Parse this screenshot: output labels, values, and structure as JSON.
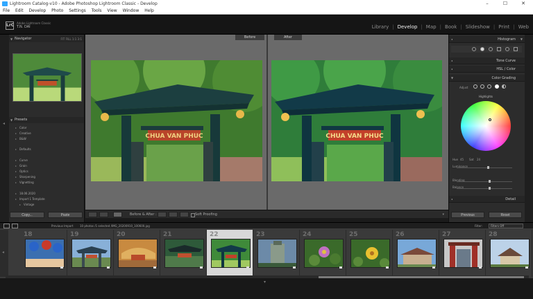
{
  "window": {
    "title": "Lightroom Catalog-v10 - Adobe Photoshop Lightroom Classic - Develop",
    "minimize": "–",
    "maximize": "☐",
    "close": "✕"
  },
  "menu": [
    "File",
    "Edit",
    "Develop",
    "Photo",
    "Settings",
    "Tools",
    "View",
    "Window",
    "Help"
  ],
  "identity": {
    "logo": "LrC",
    "line1": "Adobe Lightroom Classic",
    "line2": "T.N. DAI"
  },
  "modules": [
    {
      "label": "Library",
      "active": false
    },
    {
      "label": "Develop",
      "active": true
    },
    {
      "label": "Map",
      "active": false
    },
    {
      "label": "Book",
      "active": false
    },
    {
      "label": "Slideshow",
      "active": false
    },
    {
      "label": "Print",
      "active": false
    },
    {
      "label": "Web",
      "active": false
    }
  ],
  "left": {
    "navigator": {
      "title": "Navigator",
      "options": "FIT  FILL  1:1  3:1"
    },
    "presets": {
      "title": "Presets",
      "items": [
        "Color",
        "Creative",
        "B&W",
        "Defaults",
        "Curve",
        "Grain",
        "Optics",
        "Sharpening",
        "Vignetting",
        "18.06.2020",
        "Import 1 Template",
        "Vintage"
      ]
    },
    "copy": "Copy...",
    "paste": "Paste"
  },
  "center": {
    "before": "Before",
    "after": "After",
    "sign_text": "CHUA VAN PHUC",
    "toolbar": {
      "beforeafter": "Before & After :",
      "softproof": "Soft Proofing"
    }
  },
  "right": {
    "histogram": "Histogram",
    "tone_curve": "Tone Curve",
    "hsl": "HSL / Color",
    "color_grading": "Color Grading",
    "detail": "Detail",
    "adjust_label": "Adjust",
    "highlights": "Highlights",
    "hue": "Hue",
    "hue_val": "45",
    "sat": "Sat",
    "sat_val": "24",
    "luminance": "Luminance",
    "blending": "Blending",
    "balance": "Balance",
    "previous": "Previous",
    "reset": "Reset"
  },
  "filmstrip": {
    "import": "Previous Import",
    "count": "10 photos /1 selected /IMG_20200910_100600.jpg",
    "filter": "Filter:",
    "filter_value": "Filters Off",
    "frames": [
      {
        "num": "18",
        "kind": "lanterns"
      },
      {
        "num": "19",
        "kind": "gate-blue"
      },
      {
        "num": "20",
        "kind": "gate-orange"
      },
      {
        "num": "21",
        "kind": "gate-dark"
      },
      {
        "num": "22",
        "kind": "gate-selected",
        "selected": true
      },
      {
        "num": "23",
        "kind": "tower"
      },
      {
        "num": "24",
        "kind": "lotus"
      },
      {
        "num": "25",
        "kind": "flower-yellow"
      },
      {
        "num": "26",
        "kind": "temple"
      },
      {
        "num": "27",
        "kind": "gate-red"
      },
      {
        "num": "28",
        "kind": "pagoda"
      }
    ]
  },
  "colors": {
    "accent": "#31a8ff",
    "panel": "#2c2c2c",
    "canvas": "#6a6a6a"
  }
}
